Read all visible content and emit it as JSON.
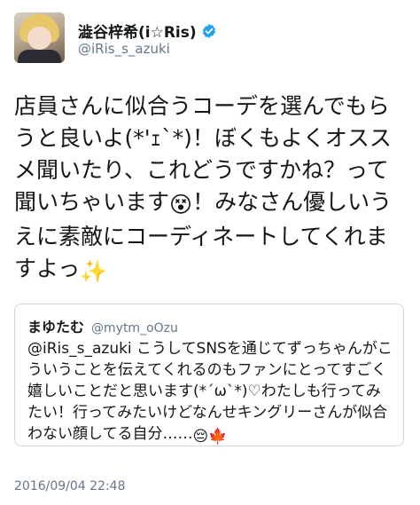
{
  "author": {
    "display_name": "澁谷梓希(i☆Ris)",
    "handle": "@iRis_s_azuki",
    "avatar_icon": "profile-photo",
    "verified_icon": "verified-badge-icon",
    "verified_color": "#1da1f2"
  },
  "tweet": {
    "text_part1": "店員さんに似合うコーデを選んでもらうと良いよ(*'ｪ`*)！ぼくもよくオススメ聞いたり、これどうですかね？って聞いちゃいます",
    "emoji1": "😵",
    "text_part2": "！みなさん優しいうえに素敵にコーディネートしてくれますよっ",
    "emoji2": "✨"
  },
  "quoted_tweet": {
    "display_name": "まゆたむ",
    "handle": "@mytm_oOzu",
    "text": "@iRis_s_azuki こうしてSNSを通じてずっちゃんがこういうことを伝えてくれるのもファンにとってすごく嬉しいことだと思います(*´ω`*)♡わたしも行ってみたい！行ってみたいけどなんせキングリーさんが似合わない顔してる自分……",
    "emoji1": "😔",
    "emoji2": "🍁"
  },
  "timestamp": "2016/09/04 22:48"
}
